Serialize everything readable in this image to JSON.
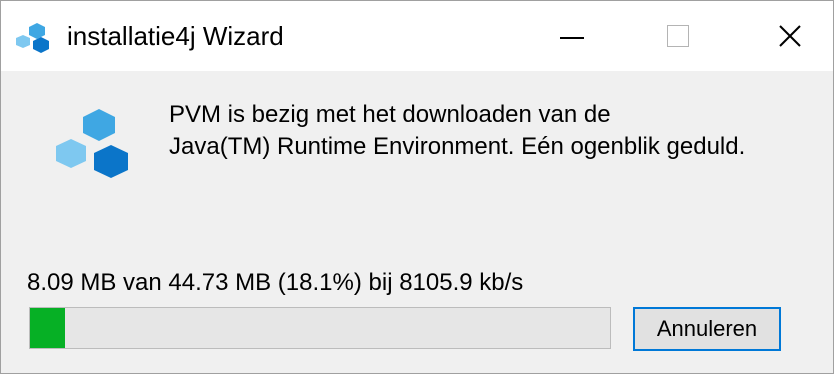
{
  "window": {
    "title": "installatie4j Wizard",
    "icon": "install4j-logo-icon",
    "controls": {
      "minimize": "minimize-icon",
      "maximize": "maximize-icon",
      "close_label": "✕"
    }
  },
  "message": {
    "line1": "PVM  is bezig met het downloaden van de",
    "line2": "Java(TM) Runtime Environment. Eén ogenblik geduld."
  },
  "download": {
    "status_text": "8.09 MB van 44.73 MB (18.1%) bij 8105.9 kb/s",
    "progress_fraction": 0.181,
    "progress_color": "#06b025"
  },
  "buttons": {
    "cancel_label": "Annuleren"
  },
  "colors": {
    "logo_light": "#7ec8f0",
    "logo_mid": "#3fa7e3",
    "logo_dark": "#0b75c9",
    "focus_border": "#0078d7"
  }
}
